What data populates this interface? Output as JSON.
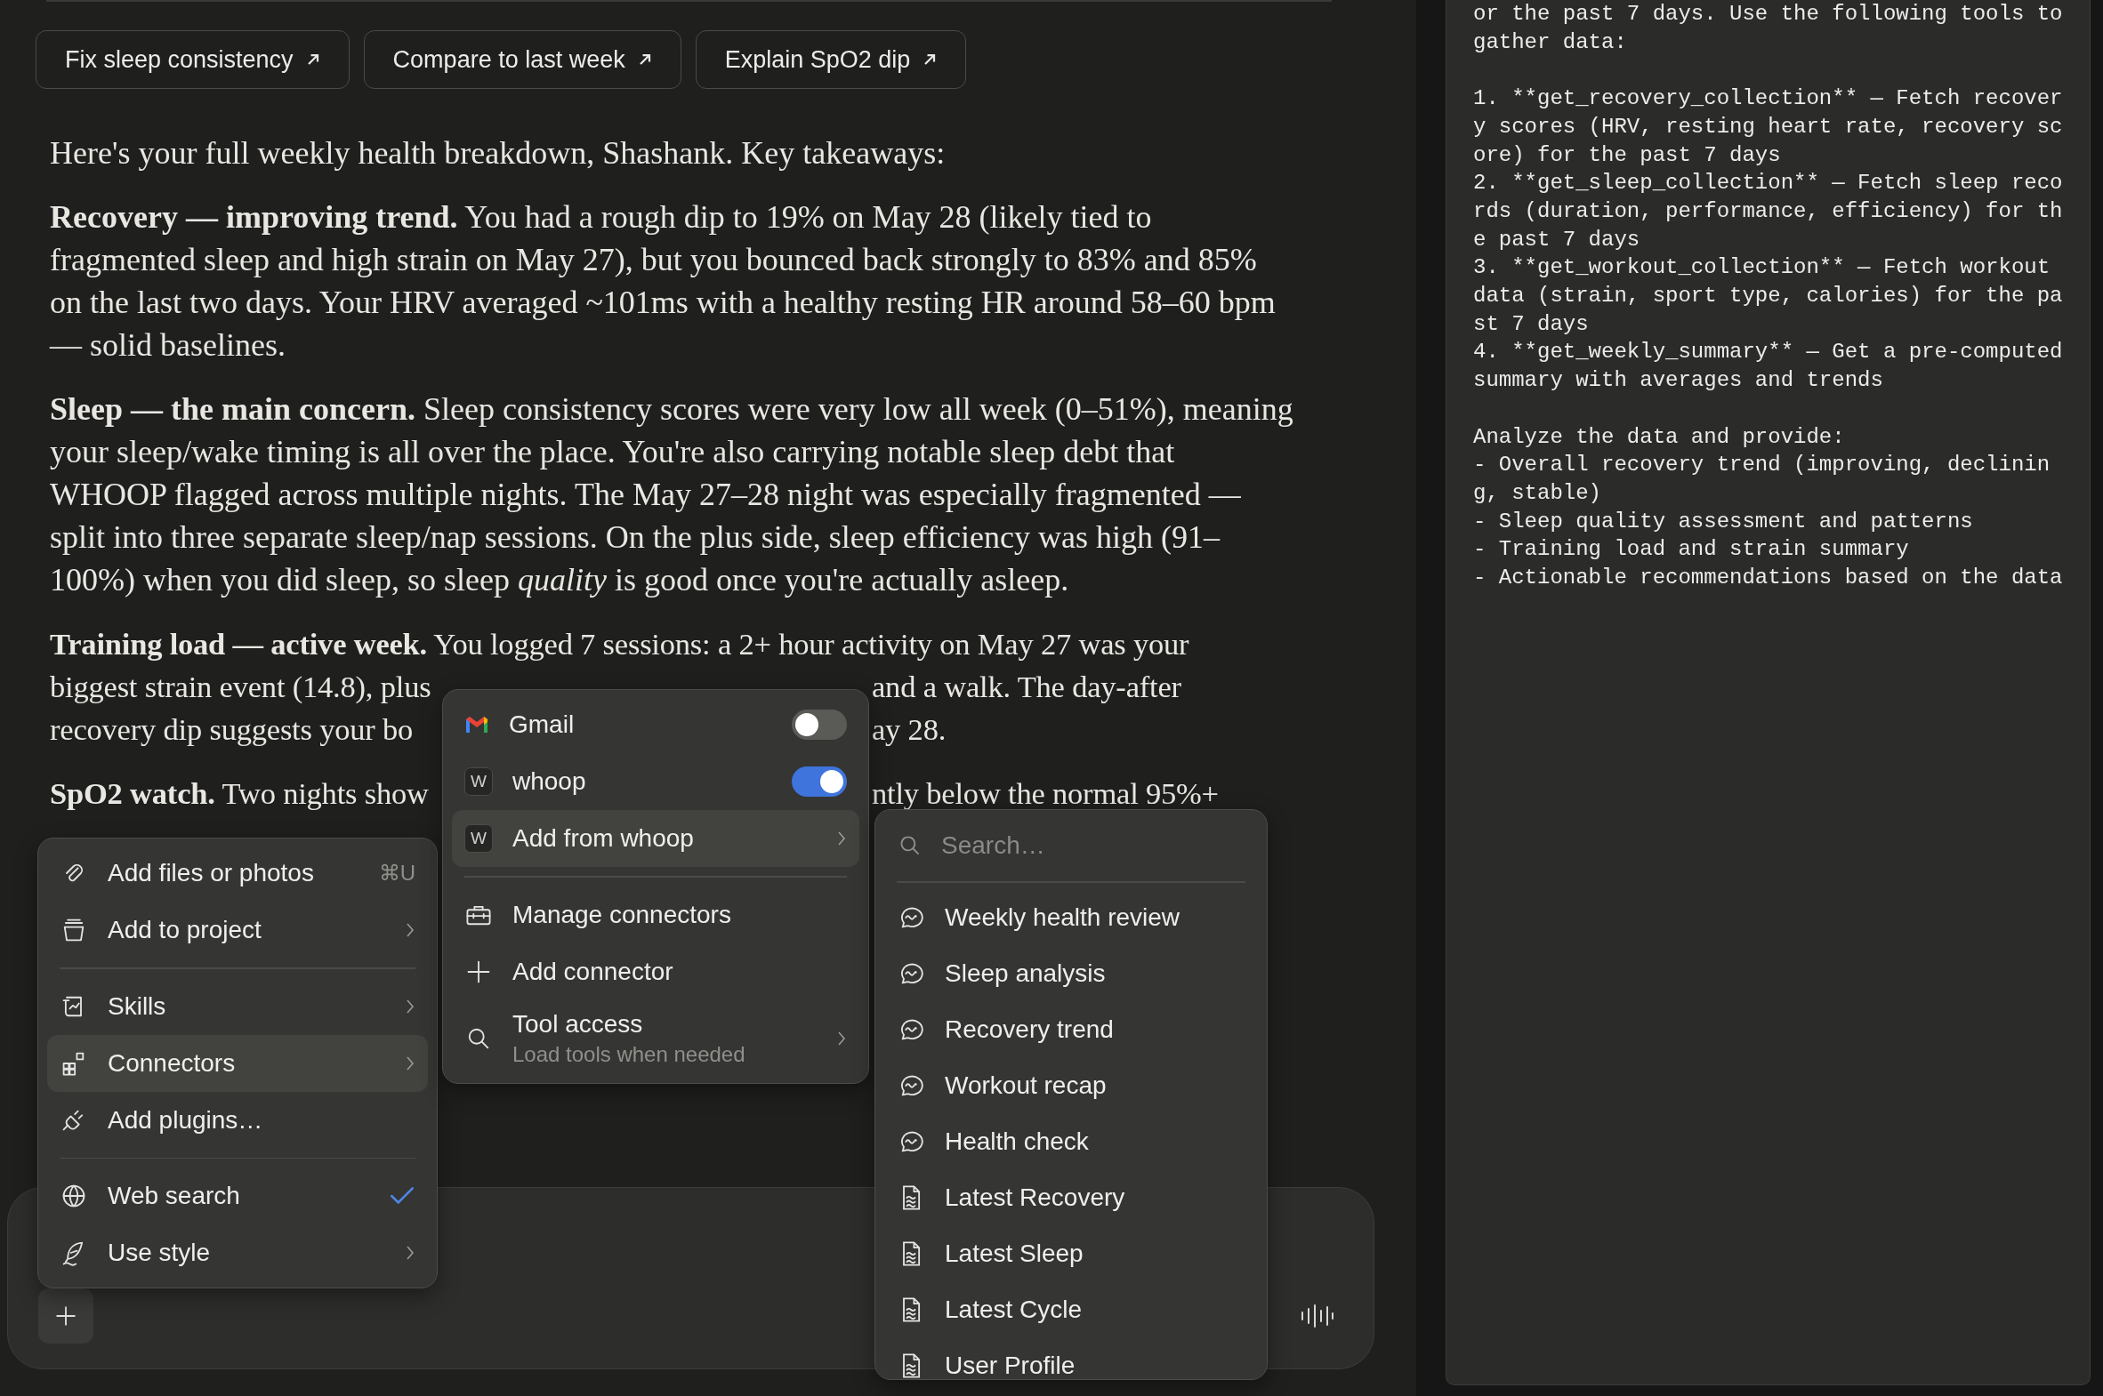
{
  "suggestions": [
    {
      "label": "Fix sleep consistency"
    },
    {
      "label": "Compare to last week"
    },
    {
      "label": "Explain SpO2 dip"
    }
  ],
  "message": {
    "paragraphs": [
      {
        "kind": "full",
        "text": "Here's your full weekly health breakdown, Shashank. Key takeaways:"
      },
      {
        "kind": "full",
        "text": "**Recovery — improving trend.** You had a rough dip to 19% on May 28 (likely tied to fragmented sleep and high strain on May 27), but you bounced back strongly to 83% and 85% on the last two days. Your HRV averaged ~101ms with a healthy resting HR around 58–60 bpm — solid baselines."
      },
      {
        "kind": "full",
        "text": "**Sleep — the main concern.** Sleep consistency scores were very low all week (0–51%), meaning your sleep/wake timing is all over the place. You're also carrying notable sleep debt that WHOOP flagged across multiple nights. The May 27–28 night was especially fragmented — split into three separate sleep/nap sessions. On the plus side, sleep efficiency was high (91–100%) when you did sleep, so sleep *quality* is good once you're actually asleep."
      },
      {
        "kind": "covered",
        "lines": [
          {
            "left": "**Training load — active week.** You logged 7 sessions: a 2+ hour activity on May 27 was your"
          },
          {
            "left": "biggest strain event (14.8), plus",
            "right": "and a walk. The day-after"
          },
          {
            "left": "recovery dip suggests your bo",
            "right": "ay 28."
          }
        ]
      },
      {
        "kind": "covered",
        "lines": [
          {
            "left": "**SpO2 watch.** Two nights show",
            "right": "ntly below the normal 95%+"
          }
        ]
      }
    ]
  },
  "attach_menu": {
    "groups": [
      {
        "items": [
          {
            "label": "Add files or photos",
            "shortcut": "⌘U",
            "submenu": false,
            "checked": false,
            "selected": false
          },
          {
            "label": "Add to project",
            "submenu": true,
            "checked": false,
            "selected": false
          }
        ]
      },
      {
        "items": [
          {
            "label": "Skills",
            "submenu": true,
            "checked": false,
            "selected": false
          },
          {
            "label": "Connectors",
            "submenu": true,
            "checked": false,
            "selected": true
          },
          {
            "label": "Add plugins…",
            "submenu": false,
            "checked": false,
            "selected": false
          }
        ]
      },
      {
        "items": [
          {
            "label": "Web search",
            "submenu": false,
            "checked": true,
            "selected": false
          },
          {
            "label": "Use style",
            "submenu": true,
            "checked": false,
            "selected": false
          }
        ]
      }
    ]
  },
  "connectors_menu": {
    "groups": [
      {
        "items": [
          {
            "kind": "toggle",
            "label": "Gmail",
            "on": false
          },
          {
            "kind": "toggle",
            "label": "whoop",
            "badge": "W",
            "on": true
          },
          {
            "kind": "submenu",
            "label": "Add from whoop",
            "badge": "W",
            "selected": true
          }
        ]
      },
      {
        "items": [
          {
            "kind": "action",
            "label": "Manage connectors"
          },
          {
            "kind": "action",
            "label": "Add connector"
          },
          {
            "kind": "submenu",
            "label": "Tool access",
            "description": "Load tools when needed",
            "selected": false
          }
        ]
      }
    ]
  },
  "whoop_menu": {
    "search": {
      "placeholder": "Search…"
    },
    "items": [
      {
        "kind": "prompt",
        "label": "Weekly health review"
      },
      {
        "kind": "prompt",
        "label": "Sleep analysis"
      },
      {
        "kind": "prompt",
        "label": "Recovery trend"
      },
      {
        "kind": "prompt",
        "label": "Workout recap"
      },
      {
        "kind": "prompt",
        "label": "Health check"
      },
      {
        "kind": "resource",
        "label": "Latest Recovery"
      },
      {
        "kind": "resource",
        "label": "Latest Sleep"
      },
      {
        "kind": "resource",
        "label": "Latest Cycle"
      },
      {
        "kind": "resource",
        "label": "User Profile"
      }
    ]
  },
  "prompt_panel": {
    "blocks": [
      [
        "or the past 7 days. Use the following tools to",
        "gather data:"
      ],
      [
        "1. **get_recovery_collection** — Fetch recover",
        "y scores (HRV, resting heart rate, recovery sc",
        "ore) for the past 7 days",
        "2. **get_sleep_collection** — Fetch sleep reco",
        "rds (duration, performance, efficiency) for th",
        "e past 7 days",
        "3. **get_workout_collection** — Fetch workout",
        "data (strain, sport type, calories) for the pa",
        "st 7 days",
        "4. **get_weekly_summary** — Get a pre-computed",
        "summary with averages and trends"
      ],
      [
        "Analyze the data and provide:",
        "- Overall recovery trend (improving, declinin",
        "g, stable)",
        "- Sleep quality assessment and patterns",
        "- Training load and strain summary",
        "- Actionable recommendations based on the data"
      ]
    ]
  }
}
